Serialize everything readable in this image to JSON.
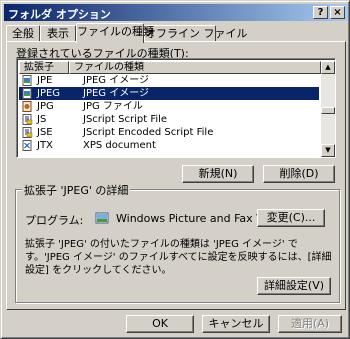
{
  "window": {
    "title": "フォルダ オプション",
    "help_glyph": "?",
    "close_glyph": "×"
  },
  "tabs": [
    {
      "label": "全般"
    },
    {
      "label": "表示"
    },
    {
      "label": "ファイルの種類"
    },
    {
      "label": "オフライン ファイル"
    }
  ],
  "filetypes": {
    "label": "登録されているファイルの種類(T):",
    "columns": [
      "拡張子",
      "ファイルの種類"
    ],
    "rows": [
      {
        "ext": "JPE",
        "type": "JPEG イメージ",
        "icon": "jpeg-image-icon",
        "selected": false
      },
      {
        "ext": "JPEG",
        "type": "JPEG イメージ",
        "icon": "jpeg-image-icon",
        "selected": true
      },
      {
        "ext": "JPG",
        "type": "JPG ファイル",
        "icon": "jpg-file-icon",
        "selected": false
      },
      {
        "ext": "JS",
        "type": "JScript Script File",
        "icon": "script-file-icon",
        "selected": false
      },
      {
        "ext": "JSE",
        "type": "JScript Encoded Script File",
        "icon": "script-file-icon",
        "selected": false
      },
      {
        "ext": "JTX",
        "type": "XPS document",
        "icon": "xps-document-icon",
        "selected": false
      }
    ],
    "scroll_up": "▲",
    "scroll_down": "▼"
  },
  "buttons": {
    "new": "新規(N)",
    "delete": "削除(D)",
    "change": "変更(C)...",
    "advanced": "詳細設定(V)",
    "ok": "OK",
    "cancel": "キャンセル",
    "apply": "適用(A)"
  },
  "details": {
    "title": "拡張子 'JPEG' の詳細",
    "program_label": "プログラム:",
    "program_name": "Windows Picture and Fax Viewer",
    "description": "拡張子 'JPEG' の付いたファイルの種類は 'JPEG イメージ' です。'JPEG イメージ' のファイルすべてに設定を反映するには、[詳細設定] をクリックしてください。"
  },
  "colors": {
    "title_gradient_start": "#0a246a",
    "title_gradient_end": "#a6caf0",
    "selection": "#0a246a",
    "face": "#d4d0c8"
  }
}
